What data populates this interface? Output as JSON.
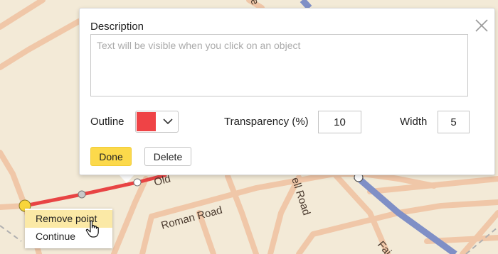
{
  "map": {
    "road_labels": {
      "roman_road": "Roman Road",
      "ell_road": "ell Road",
      "old": "Old",
      "fai": "Fai",
      "top_e": "e"
    },
    "colors": {
      "background": "#f3ead7",
      "road": "#f0c7a8",
      "railway": "#7f8fc6",
      "route_line": "#e84444"
    }
  },
  "popup": {
    "description_label": "Description",
    "description_placeholder": "Text will be visible when you click on an object",
    "description_value": "",
    "outline_label": "Outline",
    "outline_color": "#ef4346",
    "transparency_label": "Transparency (%)",
    "transparency_value": "10",
    "width_label": "Width",
    "width_value": "5",
    "done_label": "Done",
    "delete_label": "Delete",
    "close_icon": "close-icon"
  },
  "context_menu": {
    "items": [
      {
        "label": "Remove point",
        "highlighted": true
      },
      {
        "label": "Continue",
        "highlighted": false
      }
    ]
  }
}
